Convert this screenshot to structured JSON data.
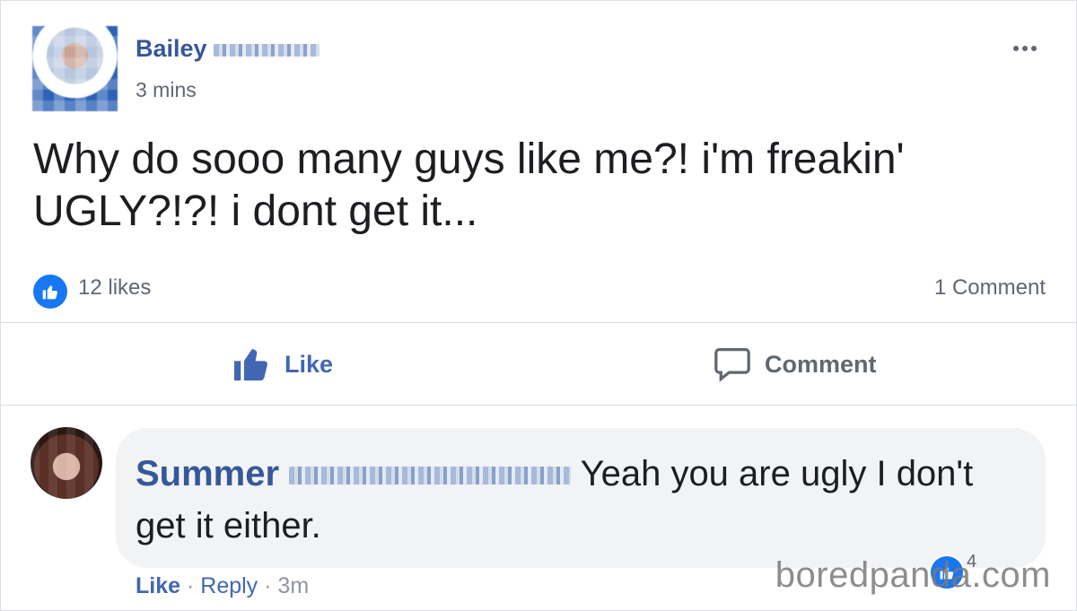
{
  "post": {
    "author_first": "Bailey",
    "time": "3 mins",
    "text": "Why do sooo many guys like me?! i'm freakin' UGLY?!?! i dont get it...",
    "likes": "12 likes",
    "comments": "1 Comment"
  },
  "actions": {
    "like": "Like",
    "comment": "Comment"
  },
  "comment": {
    "author_first": "Summer",
    "text": "Yeah you are ugly I don't get it either.",
    "like": "Like",
    "sep1": "·",
    "reply": "Reply",
    "sep2": "·",
    "time": "3m",
    "reaction_count": "4"
  },
  "watermark": "boredpanda.com",
  "colors": {
    "link": "#365899",
    "accent": "#1877f2",
    "bubble": "#f2f3f5"
  },
  "icons": [
    "more-icon",
    "like-thumb-icon",
    "comment-bubble-icon"
  ]
}
